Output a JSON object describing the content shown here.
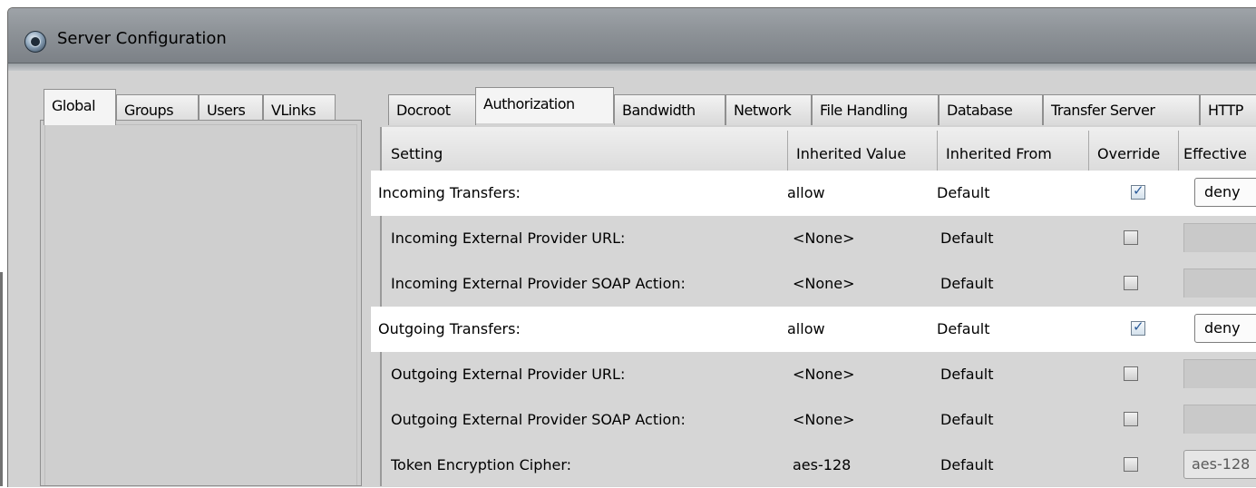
{
  "window": {
    "title": "Server Configuration"
  },
  "left_tabs": [
    {
      "label": "Global",
      "active": true
    },
    {
      "label": "Groups",
      "active": false
    },
    {
      "label": "Users",
      "active": false
    },
    {
      "label": "VLinks",
      "active": false
    }
  ],
  "right_tabs": [
    {
      "label": "Docroot",
      "active": false
    },
    {
      "label": "Authorization",
      "active": true
    },
    {
      "label": "Bandwidth",
      "active": false
    },
    {
      "label": "Network",
      "active": false
    },
    {
      "label": "File Handling",
      "active": false
    },
    {
      "label": "Database",
      "active": false
    },
    {
      "label": "Transfer Server",
      "active": false
    },
    {
      "label": "HTTP",
      "active": false
    }
  ],
  "table": {
    "headers": {
      "setting": "Setting",
      "inherited_value": "Inherited Value",
      "inherited_from": "Inherited From",
      "override": "Override",
      "effective": "Effective"
    },
    "rows": [
      {
        "setting": "Incoming Transfers:",
        "inherited_value": "allow",
        "inherited_from": "Default",
        "override": true,
        "effective": "deny",
        "highlight": true
      },
      {
        "setting": "Incoming External Provider URL:",
        "inherited_value": "<None>",
        "inherited_from": "Default",
        "override": false,
        "effective": "",
        "highlight": false
      },
      {
        "setting": "Incoming External Provider SOAP Action:",
        "inherited_value": "<None>",
        "inherited_from": "Default",
        "override": false,
        "effective": "",
        "highlight": false
      },
      {
        "setting": "Outgoing Transfers:",
        "inherited_value": "allow",
        "inherited_from": "Default",
        "override": true,
        "effective": "deny",
        "highlight": true
      },
      {
        "setting": "Outgoing External Provider URL:",
        "inherited_value": "<None>",
        "inherited_from": "Default",
        "override": false,
        "effective": "",
        "highlight": false
      },
      {
        "setting": "Outgoing External Provider SOAP Action:",
        "inherited_value": "<None>",
        "inherited_from": "Default",
        "override": false,
        "effective": "",
        "highlight": false
      },
      {
        "setting": "Token Encryption Cipher:",
        "inherited_value": "aes-128",
        "inherited_from": "Default",
        "override": false,
        "effective": "aes-128",
        "highlight": false
      }
    ]
  }
}
